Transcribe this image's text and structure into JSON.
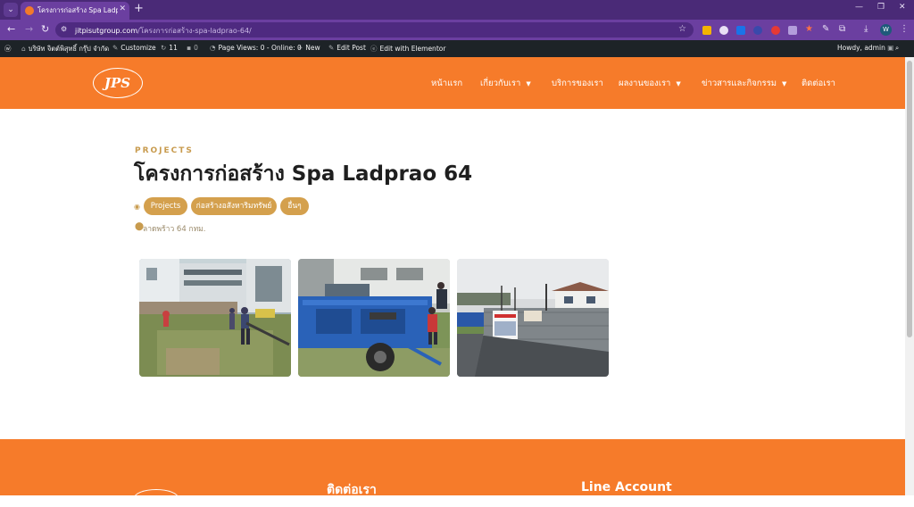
{
  "browser": {
    "tab_title": "โครงการก่อสร้าง Spa Ladprao 64",
    "url_host": "jitpisutgroup.com",
    "url_path": "/โครงการก่อสร้าง-spa-ladprao-64/",
    "profile_initial": "W"
  },
  "adminbar": {
    "site_name": "บริษัท จิตต์พิสุทธิ์ กรุ๊ป จำกัด",
    "customize": "Customize",
    "updates_count": "11",
    "comments_count": "0",
    "page_views": "Page Views: 0 - Online: 0",
    "new": "New",
    "edit_post": "Edit Post",
    "edit_elementor": "Edit with Elementor",
    "howdy": "Howdy, admin"
  },
  "header": {
    "logo_text": "JPS",
    "menu": [
      {
        "label": "หน้าแรก"
      },
      {
        "label": "เกี่ยวกับเรา"
      },
      {
        "label": "บริการของเรา"
      },
      {
        "label": "ผลงานของเรา"
      },
      {
        "label": "ข่าวสารและกิจกรรม"
      },
      {
        "label": "ติดต่อเรา"
      }
    ]
  },
  "main": {
    "kicker": "PROJECTS",
    "title": "โครงการก่อสร้าง Spa Ladprao 64",
    "categories": [
      "Projects",
      "ก่อสร้างอสังหาริมทรัพย์",
      "อื่นๆ"
    ],
    "location": "ลาดพร้าว 64 กทม."
  },
  "footer": {
    "contact_heading": "ติดต่อเรา",
    "line_heading": "Line Account"
  }
}
